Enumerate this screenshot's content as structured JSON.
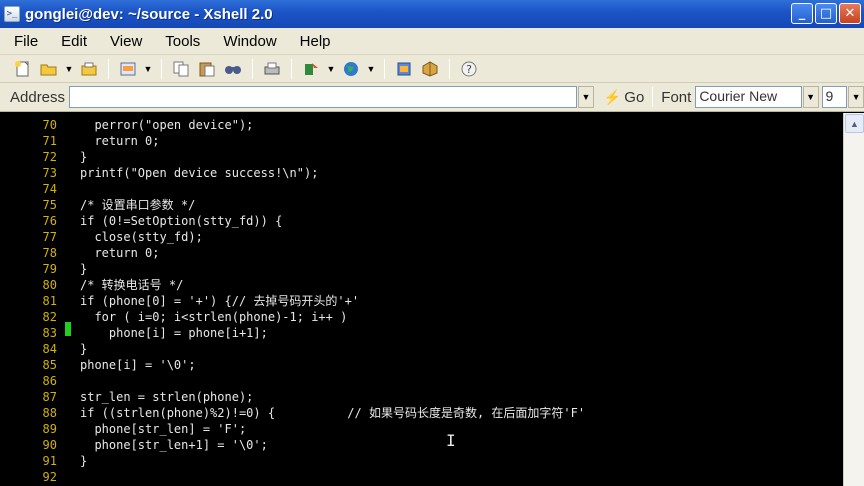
{
  "window": {
    "title": "gonglei@dev: ~/source - Xshell 2.0",
    "minimize_label": "_",
    "maximize_label": "□",
    "close_label": "✕"
  },
  "menu": [
    "File",
    "Edit",
    "View",
    "Tools",
    "Window",
    "Help"
  ],
  "toolbar": {
    "icons": [
      "new-session-icon",
      "open-folder-icon",
      "properties-icon",
      "reconnect-icon",
      "copy-icon",
      "paste-icon",
      "find-icon",
      "print-icon",
      "transfer-icon",
      "globe-icon",
      "script-icon",
      "options-icon",
      "help-icon"
    ]
  },
  "address": {
    "label": "Address",
    "value": "",
    "go_label": "Go"
  },
  "font": {
    "label": "Font",
    "family": "Courier New",
    "size": "9"
  },
  "terminal": {
    "lines": [
      {
        "num": "70",
        "code": "  perror(\"open device\");",
        "marker": false
      },
      {
        "num": "71",
        "code": "  return 0;",
        "marker": false
      },
      {
        "num": "72",
        "code": "}",
        "marker": false
      },
      {
        "num": "73",
        "code": "printf(\"Open device success!\\n\");",
        "marker": false
      },
      {
        "num": "74",
        "code": "",
        "marker": false
      },
      {
        "num": "75",
        "code": "/* 设置串口参数 */",
        "marker": false
      },
      {
        "num": "76",
        "code": "if (0!=SetOption(stty_fd)) {",
        "marker": false
      },
      {
        "num": "77",
        "code": "  close(stty_fd);",
        "marker": false
      },
      {
        "num": "78",
        "code": "  return 0;",
        "marker": false
      },
      {
        "num": "79",
        "code": "}",
        "marker": false
      },
      {
        "num": "80",
        "code": "/* 转换电话号 */",
        "marker": false
      },
      {
        "num": "81",
        "code": "if (phone[0] = '+') {// 去掉号码开头的'+'",
        "marker": false
      },
      {
        "num": "82",
        "code": "  for ( i=0; i<strlen(phone)-1; i++ )",
        "marker": true
      },
      {
        "num": "83",
        "code": "    phone[i] = phone[i+1];",
        "marker": false
      },
      {
        "num": "84",
        "code": "}",
        "marker": false
      },
      {
        "num": "85",
        "code": "phone[i] = '\\0';",
        "marker": false
      },
      {
        "num": "86",
        "code": "",
        "marker": false
      },
      {
        "num": "87",
        "code": "str_len = strlen(phone);",
        "marker": false
      },
      {
        "num": "88",
        "code": "if ((strlen(phone)%2)!=0) {          // 如果号码长度是奇数, 在后面加字符'F'",
        "marker": false
      },
      {
        "num": "89",
        "code": "  phone[str_len] = 'F';",
        "marker": false
      },
      {
        "num": "90",
        "code": "  phone[str_len+1] = '\\0';",
        "marker": false
      },
      {
        "num": "91",
        "code": "}",
        "marker": false
      },
      {
        "num": "92",
        "code": "",
        "marker": false
      }
    ]
  },
  "scrollbar": {
    "up_label": "▲"
  }
}
